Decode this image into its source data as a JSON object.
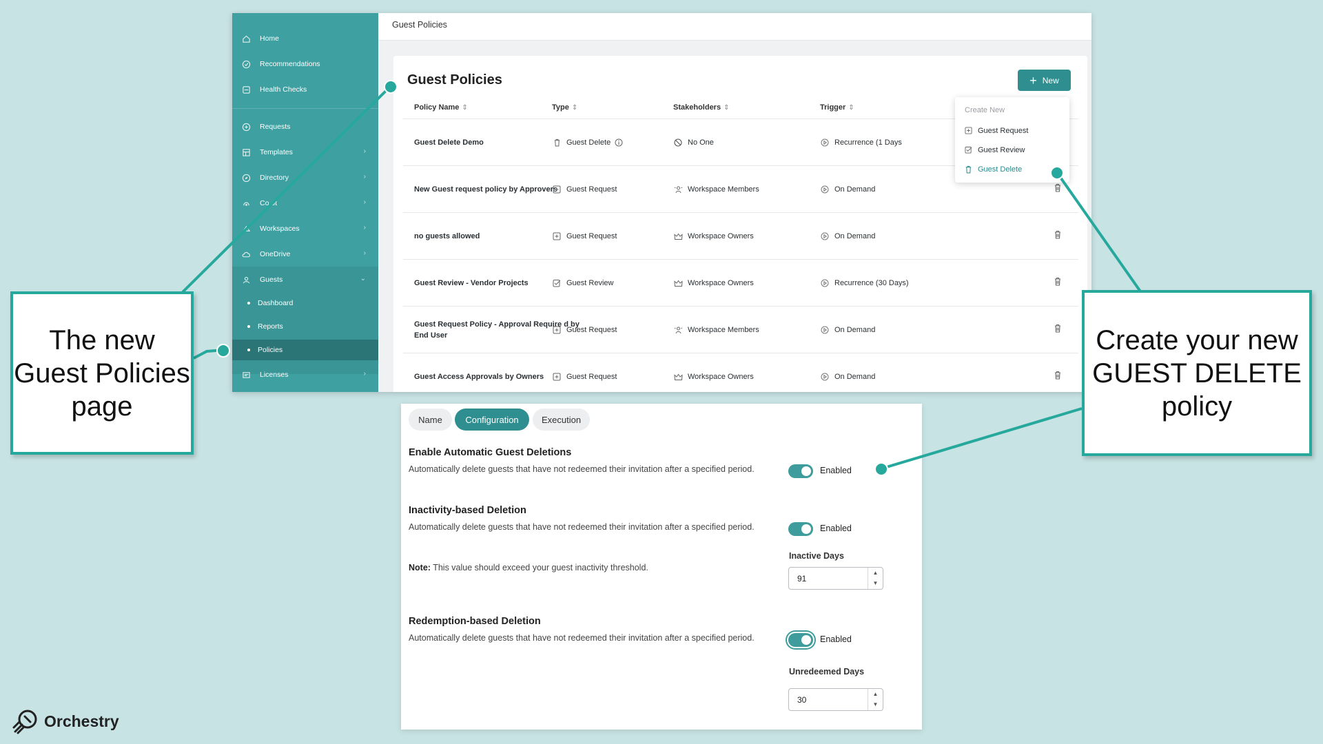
{
  "sidebar": {
    "items": [
      {
        "label": "Home"
      },
      {
        "label": "Recommendations"
      },
      {
        "label": "Health Checks"
      },
      {
        "label": "Requests"
      },
      {
        "label": "Templates"
      },
      {
        "label": "Directory"
      },
      {
        "label": "Co     ot"
      },
      {
        "label": "Workspaces"
      },
      {
        "label": "OneDrive"
      },
      {
        "label": "Guests"
      },
      {
        "label": "Licenses"
      }
    ],
    "guest_sub": [
      "Dashboard",
      "Reports",
      "Policies"
    ]
  },
  "topbar": {
    "breadcrumb": "Guest Policies"
  },
  "page": {
    "title": "Guest Policies",
    "new_label": "New"
  },
  "table": {
    "headers": [
      "Policy Name",
      "Type",
      "Stakeholders",
      "Trigger"
    ],
    "rows": [
      {
        "name": "Guest Delete Demo",
        "type": "Guest Delete",
        "stakeholders": "No One",
        "trigger": "Recurrence (1 Days"
      },
      {
        "name": "New Guest request policy by Approvers",
        "type": "Guest Request",
        "stakeholders": "Workspace Members",
        "trigger": "On Demand"
      },
      {
        "name": "no guests allowed",
        "type": "Guest Request",
        "stakeholders": "Workspace Owners",
        "trigger": "On Demand"
      },
      {
        "name": "Guest Review - Vendor Projects",
        "type": "Guest Review",
        "stakeholders": "Workspace Owners",
        "trigger": "Recurrence (30 Days)"
      },
      {
        "name": "Guest Request Policy - Approval Require d by End User",
        "type": "Guest Request",
        "stakeholders": "Workspace Members",
        "trigger": "On Demand"
      },
      {
        "name": "Guest Access Approvals by Owners",
        "type": "Guest Request",
        "stakeholders": "Workspace Owners",
        "trigger": "On Demand"
      }
    ]
  },
  "create_menu": {
    "header": "Create New",
    "items": [
      "Guest Request",
      "Guest Review",
      "Guest Delete"
    ]
  },
  "config": {
    "tabs": [
      "Name",
      "Configuration",
      "Execution"
    ],
    "auto": {
      "title": "Enable Automatic Guest Deletions",
      "desc": "Automatically delete guests that have not redeemed their invitation after a specified period.",
      "toggle": "Enabled"
    },
    "inactivity": {
      "title": "Inactivity-based Deletion",
      "desc": "Automatically delete guests that have not redeemed their invitation after a specified period.",
      "toggle": "Enabled",
      "note_bold": "Note:",
      "note_text": " This value should exceed your guest inactivity threshold.",
      "field_label": "Inactive Days",
      "value": "91"
    },
    "redemption": {
      "title": "Redemption-based Deletion",
      "desc": "Automatically delete guests that have not redeemed their invitation after a specified period.",
      "toggle": "Enabled",
      "field_label": "Unredeemed Days",
      "value": "30"
    }
  },
  "callouts": {
    "left": "The new Guest Policies page",
    "right": "Create your new GUEST DELETE policy"
  },
  "brand": {
    "name": "Orchestry",
    "accent": "#26a99c",
    "sidebar": "#3fa0a1",
    "primary": "#2f8f90"
  }
}
